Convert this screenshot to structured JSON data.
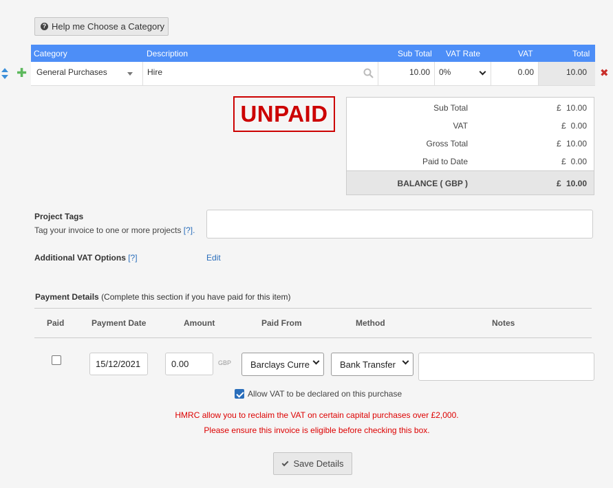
{
  "help_button": {
    "label": "Help me Choose a Category"
  },
  "line_items": {
    "headers": {
      "category": "Category",
      "description": "Description",
      "sub_total": "Sub Total",
      "vat_rate": "VAT Rate",
      "vat": "VAT",
      "total": "Total"
    },
    "rows": [
      {
        "category": "General Purchases",
        "description": "Hire",
        "sub_total": "10.00",
        "vat_rate": "0%",
        "vat": "0.00",
        "total": "10.00"
      }
    ]
  },
  "status_stamp": "UNPAID",
  "totals": {
    "currency_symbol": "£",
    "rows": [
      {
        "label": "Sub Total",
        "value": "10.00"
      },
      {
        "label": "VAT",
        "value": "0.00"
      },
      {
        "label": "Gross Total",
        "value": "10.00"
      },
      {
        "label": "Paid to Date",
        "value": "0.00"
      }
    ],
    "balance": {
      "label": "BALANCE ( GBP )",
      "value": "10.00"
    }
  },
  "project_tags": {
    "title": "Project Tags",
    "hint": "Tag your invoice to one or more projects",
    "help": "[?]."
  },
  "vat_options": {
    "title": "Additional VAT Options",
    "help": "[?]",
    "edit_label": "Edit"
  },
  "payment_details": {
    "title": "Payment Details",
    "subtitle": "(Complete this section if you have paid for this item)",
    "headers": {
      "paid": "Paid",
      "date": "Payment Date",
      "amount": "Amount",
      "paid_from": "Paid From",
      "method": "Method",
      "notes": "Notes"
    },
    "row": {
      "paid": false,
      "date": "15/12/2021",
      "amount": "0.00",
      "currency": "GBP",
      "paid_from": "Barclays Curre",
      "method": "Bank Transfer",
      "notes": ""
    },
    "allow_vat": {
      "checked": true,
      "label": "Allow VAT to be declared on this purchase"
    },
    "warning_line1": "HMRC allow you to reclaim the VAT on certain capital purchases over £2,000.",
    "warning_line2": "Please ensure this invoice is eligible before checking this box."
  },
  "save_button": {
    "label": "Save Details"
  },
  "colors": {
    "header_blue": "#4d8ef7",
    "stamp_red": "#cc0000",
    "link_blue": "#2a6ebb",
    "add_green": "#5cb85c",
    "remove_red": "#c9302c"
  }
}
